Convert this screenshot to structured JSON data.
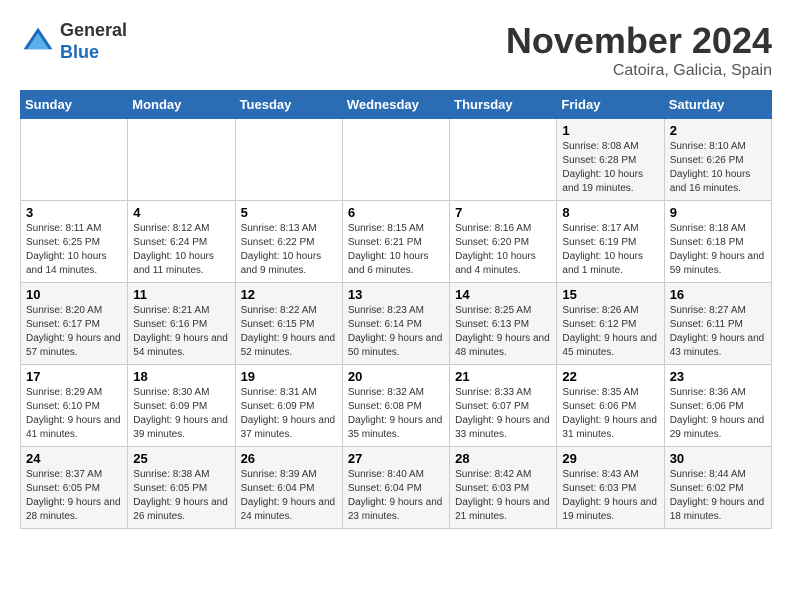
{
  "header": {
    "logo_general": "General",
    "logo_blue": "Blue",
    "month_title": "November 2024",
    "location": "Catoira, Galicia, Spain"
  },
  "days_of_week": [
    "Sunday",
    "Monday",
    "Tuesday",
    "Wednesday",
    "Thursday",
    "Friday",
    "Saturday"
  ],
  "weeks": [
    [
      {
        "num": "",
        "info": ""
      },
      {
        "num": "",
        "info": ""
      },
      {
        "num": "",
        "info": ""
      },
      {
        "num": "",
        "info": ""
      },
      {
        "num": "",
        "info": ""
      },
      {
        "num": "1",
        "info": "Sunrise: 8:08 AM\nSunset: 6:28 PM\nDaylight: 10 hours and 19 minutes."
      },
      {
        "num": "2",
        "info": "Sunrise: 8:10 AM\nSunset: 6:26 PM\nDaylight: 10 hours and 16 minutes."
      }
    ],
    [
      {
        "num": "3",
        "info": "Sunrise: 8:11 AM\nSunset: 6:25 PM\nDaylight: 10 hours and 14 minutes."
      },
      {
        "num": "4",
        "info": "Sunrise: 8:12 AM\nSunset: 6:24 PM\nDaylight: 10 hours and 11 minutes."
      },
      {
        "num": "5",
        "info": "Sunrise: 8:13 AM\nSunset: 6:22 PM\nDaylight: 10 hours and 9 minutes."
      },
      {
        "num": "6",
        "info": "Sunrise: 8:15 AM\nSunset: 6:21 PM\nDaylight: 10 hours and 6 minutes."
      },
      {
        "num": "7",
        "info": "Sunrise: 8:16 AM\nSunset: 6:20 PM\nDaylight: 10 hours and 4 minutes."
      },
      {
        "num": "8",
        "info": "Sunrise: 8:17 AM\nSunset: 6:19 PM\nDaylight: 10 hours and 1 minute."
      },
      {
        "num": "9",
        "info": "Sunrise: 8:18 AM\nSunset: 6:18 PM\nDaylight: 9 hours and 59 minutes."
      }
    ],
    [
      {
        "num": "10",
        "info": "Sunrise: 8:20 AM\nSunset: 6:17 PM\nDaylight: 9 hours and 57 minutes."
      },
      {
        "num": "11",
        "info": "Sunrise: 8:21 AM\nSunset: 6:16 PM\nDaylight: 9 hours and 54 minutes."
      },
      {
        "num": "12",
        "info": "Sunrise: 8:22 AM\nSunset: 6:15 PM\nDaylight: 9 hours and 52 minutes."
      },
      {
        "num": "13",
        "info": "Sunrise: 8:23 AM\nSunset: 6:14 PM\nDaylight: 9 hours and 50 minutes."
      },
      {
        "num": "14",
        "info": "Sunrise: 8:25 AM\nSunset: 6:13 PM\nDaylight: 9 hours and 48 minutes."
      },
      {
        "num": "15",
        "info": "Sunrise: 8:26 AM\nSunset: 6:12 PM\nDaylight: 9 hours and 45 minutes."
      },
      {
        "num": "16",
        "info": "Sunrise: 8:27 AM\nSunset: 6:11 PM\nDaylight: 9 hours and 43 minutes."
      }
    ],
    [
      {
        "num": "17",
        "info": "Sunrise: 8:29 AM\nSunset: 6:10 PM\nDaylight: 9 hours and 41 minutes."
      },
      {
        "num": "18",
        "info": "Sunrise: 8:30 AM\nSunset: 6:09 PM\nDaylight: 9 hours and 39 minutes."
      },
      {
        "num": "19",
        "info": "Sunrise: 8:31 AM\nSunset: 6:09 PM\nDaylight: 9 hours and 37 minutes."
      },
      {
        "num": "20",
        "info": "Sunrise: 8:32 AM\nSunset: 6:08 PM\nDaylight: 9 hours and 35 minutes."
      },
      {
        "num": "21",
        "info": "Sunrise: 8:33 AM\nSunset: 6:07 PM\nDaylight: 9 hours and 33 minutes."
      },
      {
        "num": "22",
        "info": "Sunrise: 8:35 AM\nSunset: 6:06 PM\nDaylight: 9 hours and 31 minutes."
      },
      {
        "num": "23",
        "info": "Sunrise: 8:36 AM\nSunset: 6:06 PM\nDaylight: 9 hours and 29 minutes."
      }
    ],
    [
      {
        "num": "24",
        "info": "Sunrise: 8:37 AM\nSunset: 6:05 PM\nDaylight: 9 hours and 28 minutes."
      },
      {
        "num": "25",
        "info": "Sunrise: 8:38 AM\nSunset: 6:05 PM\nDaylight: 9 hours and 26 minutes."
      },
      {
        "num": "26",
        "info": "Sunrise: 8:39 AM\nSunset: 6:04 PM\nDaylight: 9 hours and 24 minutes."
      },
      {
        "num": "27",
        "info": "Sunrise: 8:40 AM\nSunset: 6:04 PM\nDaylight: 9 hours and 23 minutes."
      },
      {
        "num": "28",
        "info": "Sunrise: 8:42 AM\nSunset: 6:03 PM\nDaylight: 9 hours and 21 minutes."
      },
      {
        "num": "29",
        "info": "Sunrise: 8:43 AM\nSunset: 6:03 PM\nDaylight: 9 hours and 19 minutes."
      },
      {
        "num": "30",
        "info": "Sunrise: 8:44 AM\nSunset: 6:02 PM\nDaylight: 9 hours and 18 minutes."
      }
    ]
  ]
}
